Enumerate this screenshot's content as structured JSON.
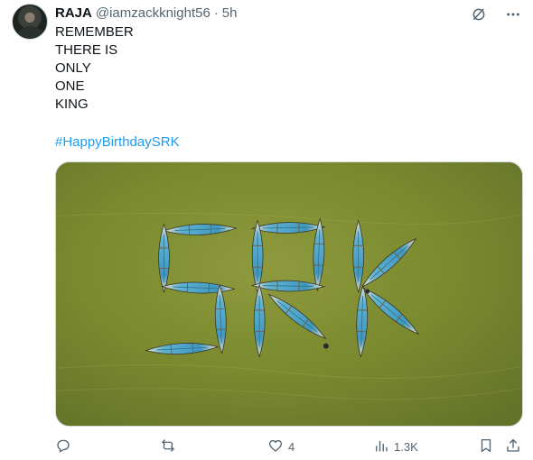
{
  "author": {
    "name": "RAJA",
    "handle": "@iamzackknight56",
    "separator": "·",
    "time": "5h"
  },
  "tweet": {
    "lines": [
      "REMEMBER",
      "THERE IS",
      "ONLY",
      "ONE",
      "KING"
    ],
    "hashtag": "#HappyBirthdaySRK"
  },
  "media": {
    "description_icon": "image",
    "water_color": "#7b8a2d",
    "boat_colors": [
      "#4aa3c8",
      "#e9e4d3"
    ]
  },
  "actions": {
    "reply_count": "",
    "repost_count": "",
    "like_count": "4",
    "views_count": "1.3K"
  },
  "icons": {
    "grok": "grok-icon",
    "more": "more-icon",
    "reply": "reply-icon",
    "repost": "repost-icon",
    "like": "like-icon",
    "views": "views-icon",
    "bookmark": "bookmark-icon",
    "share": "share-icon"
  }
}
